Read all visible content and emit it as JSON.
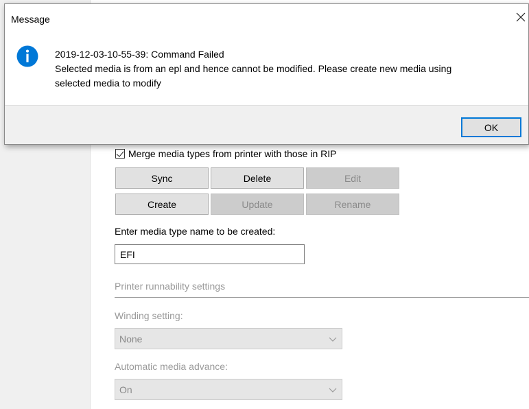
{
  "dialog": {
    "title": "Message",
    "message_line1": "2019-12-03-10-55-39:  Command Failed",
    "message_line2": "Selected media is from an epl and hence cannot be modified. Please create new media using",
    "message_line3": "selected media to modify",
    "ok_label": "OK"
  },
  "media": {
    "merge_label": "Merge media types from printer with those in RIP",
    "merge_checked": true,
    "buttons": {
      "sync": "Sync",
      "delete": "Delete",
      "edit": "Edit",
      "create": "Create",
      "update": "Update",
      "rename": "Rename"
    },
    "enter_name_label": "Enter media type name to be created:",
    "name_value": "EFI"
  },
  "runnability": {
    "section_title": "Printer runnability settings",
    "winding_label": "Winding setting:",
    "winding_value": "None",
    "advance_label": "Automatic media advance:",
    "advance_value": "On"
  },
  "colors": {
    "accent": "#0078d7",
    "info_icon": "#0078d7",
    "disabled_text": "#8a8a8a"
  },
  "icons": {
    "info": "info-icon",
    "close": "close-icon",
    "checkmark": "checkmark-icon",
    "dropdown": "chevron-down-icon"
  }
}
